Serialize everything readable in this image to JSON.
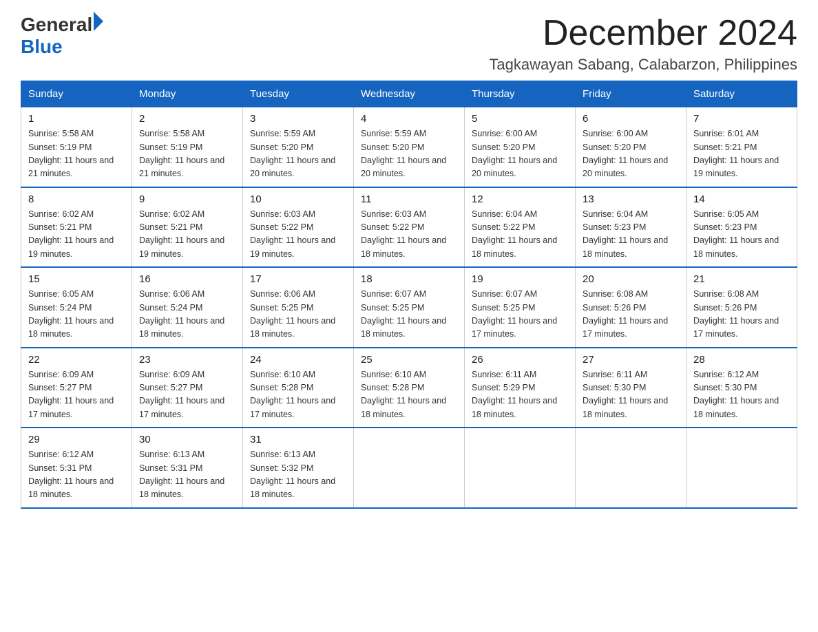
{
  "header": {
    "logo_general": "General",
    "logo_blue": "Blue",
    "month_title": "December 2024",
    "location": "Tagkawayan Sabang, Calabarzon, Philippines"
  },
  "weekdays": [
    "Sunday",
    "Monday",
    "Tuesday",
    "Wednesday",
    "Thursday",
    "Friday",
    "Saturday"
  ],
  "weeks": [
    [
      {
        "day": "1",
        "sunrise": "5:58 AM",
        "sunset": "5:19 PM",
        "daylight": "11 hours and 21 minutes."
      },
      {
        "day": "2",
        "sunrise": "5:58 AM",
        "sunset": "5:19 PM",
        "daylight": "11 hours and 21 minutes."
      },
      {
        "day": "3",
        "sunrise": "5:59 AM",
        "sunset": "5:20 PM",
        "daylight": "11 hours and 20 minutes."
      },
      {
        "day": "4",
        "sunrise": "5:59 AM",
        "sunset": "5:20 PM",
        "daylight": "11 hours and 20 minutes."
      },
      {
        "day": "5",
        "sunrise": "6:00 AM",
        "sunset": "5:20 PM",
        "daylight": "11 hours and 20 minutes."
      },
      {
        "day": "6",
        "sunrise": "6:00 AM",
        "sunset": "5:20 PM",
        "daylight": "11 hours and 20 minutes."
      },
      {
        "day": "7",
        "sunrise": "6:01 AM",
        "sunset": "5:21 PM",
        "daylight": "11 hours and 19 minutes."
      }
    ],
    [
      {
        "day": "8",
        "sunrise": "6:02 AM",
        "sunset": "5:21 PM",
        "daylight": "11 hours and 19 minutes."
      },
      {
        "day": "9",
        "sunrise": "6:02 AM",
        "sunset": "5:21 PM",
        "daylight": "11 hours and 19 minutes."
      },
      {
        "day": "10",
        "sunrise": "6:03 AM",
        "sunset": "5:22 PM",
        "daylight": "11 hours and 19 minutes."
      },
      {
        "day": "11",
        "sunrise": "6:03 AM",
        "sunset": "5:22 PM",
        "daylight": "11 hours and 18 minutes."
      },
      {
        "day": "12",
        "sunrise": "6:04 AM",
        "sunset": "5:22 PM",
        "daylight": "11 hours and 18 minutes."
      },
      {
        "day": "13",
        "sunrise": "6:04 AM",
        "sunset": "5:23 PM",
        "daylight": "11 hours and 18 minutes."
      },
      {
        "day": "14",
        "sunrise": "6:05 AM",
        "sunset": "5:23 PM",
        "daylight": "11 hours and 18 minutes."
      }
    ],
    [
      {
        "day": "15",
        "sunrise": "6:05 AM",
        "sunset": "5:24 PM",
        "daylight": "11 hours and 18 minutes."
      },
      {
        "day": "16",
        "sunrise": "6:06 AM",
        "sunset": "5:24 PM",
        "daylight": "11 hours and 18 minutes."
      },
      {
        "day": "17",
        "sunrise": "6:06 AM",
        "sunset": "5:25 PM",
        "daylight": "11 hours and 18 minutes."
      },
      {
        "day": "18",
        "sunrise": "6:07 AM",
        "sunset": "5:25 PM",
        "daylight": "11 hours and 18 minutes."
      },
      {
        "day": "19",
        "sunrise": "6:07 AM",
        "sunset": "5:25 PM",
        "daylight": "11 hours and 17 minutes."
      },
      {
        "day": "20",
        "sunrise": "6:08 AM",
        "sunset": "5:26 PM",
        "daylight": "11 hours and 17 minutes."
      },
      {
        "day": "21",
        "sunrise": "6:08 AM",
        "sunset": "5:26 PM",
        "daylight": "11 hours and 17 minutes."
      }
    ],
    [
      {
        "day": "22",
        "sunrise": "6:09 AM",
        "sunset": "5:27 PM",
        "daylight": "11 hours and 17 minutes."
      },
      {
        "day": "23",
        "sunrise": "6:09 AM",
        "sunset": "5:27 PM",
        "daylight": "11 hours and 17 minutes."
      },
      {
        "day": "24",
        "sunrise": "6:10 AM",
        "sunset": "5:28 PM",
        "daylight": "11 hours and 17 minutes."
      },
      {
        "day": "25",
        "sunrise": "6:10 AM",
        "sunset": "5:28 PM",
        "daylight": "11 hours and 18 minutes."
      },
      {
        "day": "26",
        "sunrise": "6:11 AM",
        "sunset": "5:29 PM",
        "daylight": "11 hours and 18 minutes."
      },
      {
        "day": "27",
        "sunrise": "6:11 AM",
        "sunset": "5:30 PM",
        "daylight": "11 hours and 18 minutes."
      },
      {
        "day": "28",
        "sunrise": "6:12 AM",
        "sunset": "5:30 PM",
        "daylight": "11 hours and 18 minutes."
      }
    ],
    [
      {
        "day": "29",
        "sunrise": "6:12 AM",
        "sunset": "5:31 PM",
        "daylight": "11 hours and 18 minutes."
      },
      {
        "day": "30",
        "sunrise": "6:13 AM",
        "sunset": "5:31 PM",
        "daylight": "11 hours and 18 minutes."
      },
      {
        "day": "31",
        "sunrise": "6:13 AM",
        "sunset": "5:32 PM",
        "daylight": "11 hours and 18 minutes."
      },
      null,
      null,
      null,
      null
    ]
  ]
}
